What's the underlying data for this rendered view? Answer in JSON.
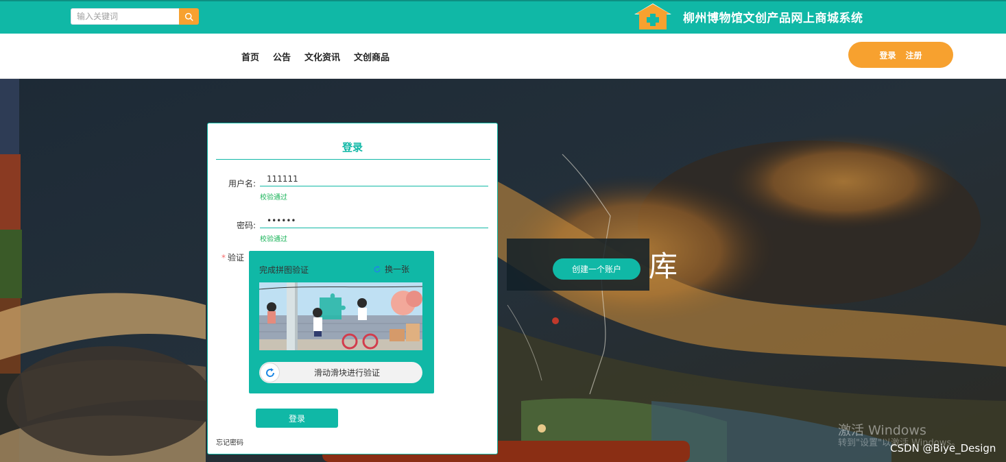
{
  "header": {
    "search_placeholder": "输入关键词",
    "site_title": "柳州博物馆文创产品网上商城系统",
    "search_icon": "search-icon",
    "logo_icon": "house-plus-logo",
    "colors": {
      "primary": "#10b8a6",
      "accent": "#f7a12f"
    }
  },
  "nav": {
    "items": [
      {
        "label": "首页"
      },
      {
        "label": "公告"
      },
      {
        "label": "文化资讯"
      },
      {
        "label": "文创商品"
      }
    ],
    "login_label": "登录",
    "register_label": "注册"
  },
  "hero": {
    "create_account_label": "创建一个账户",
    "brush_text": "库",
    "watermark_title": "激活 Windows",
    "watermark_sub": "转到\"设置\"以激活 Windows。",
    "credit": "CSDN @Biye_Design"
  },
  "login": {
    "title": "登录",
    "username_label": "用户名:",
    "username_value": "111111",
    "username_status": "校验通过",
    "password_label": "密码:",
    "password_value": "111111",
    "password_status": "校验通过",
    "verify_label": "验证",
    "captcha": {
      "title": "完成拼图验证",
      "refresh_label": "换一张",
      "slider_text": "滑动滑块进行验证"
    },
    "submit_label": "登录",
    "forgot_label": "忘记密码"
  }
}
